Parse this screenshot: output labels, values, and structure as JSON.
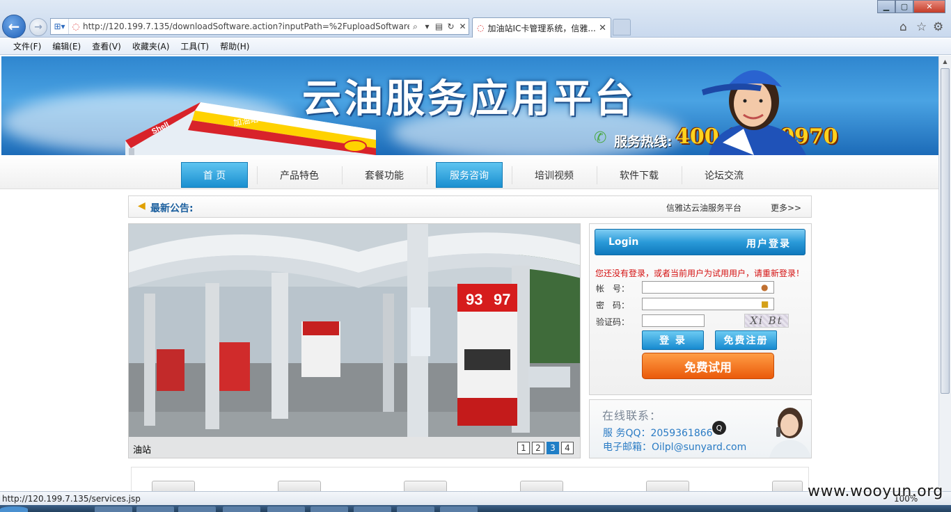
{
  "browser": {
    "url": "http://120.199.7.135/downloadSoftware.action?inputPath=%2FuploadSoftware%",
    "tab_title": "加油站IC卡管理系统，信雅...",
    "menu": [
      "文件(F)",
      "编辑(E)",
      "查看(V)",
      "收藏夹(A)",
      "工具(T)",
      "帮助(H)"
    ],
    "status_url": "http://120.199.7.135/services.jsp",
    "zoom": "100%"
  },
  "banner": {
    "title": "云油服务应用平台",
    "hotline_label": "服务热线:",
    "hotline_number": "400-826-0970",
    "canopy_text": "加油站",
    "brand": "Shell"
  },
  "nav": [
    {
      "label": "首 页",
      "active": true
    },
    {
      "label": "产品特色",
      "active": false
    },
    {
      "label": "套餐功能",
      "active": false
    },
    {
      "label": "服务咨询",
      "active": true
    },
    {
      "label": "培训视频",
      "active": false
    },
    {
      "label": "软件下载",
      "active": false
    },
    {
      "label": "论坛交流",
      "active": false
    }
  ],
  "notice": {
    "label": "最新公告:",
    "ticker": "信雅达云油服务平台",
    "more": "更多>>"
  },
  "slideshow": {
    "caption": "油站",
    "pages": [
      "1",
      "2",
      "3",
      "4"
    ],
    "active_page": 3,
    "pump_price_1": "93",
    "pump_price_2": "97"
  },
  "login": {
    "header_en": "Login",
    "header_cn": "用户登录",
    "warning": "您还没有登录，或者当前用户为试用用户，请重新登录！",
    "account_label": "帐　号：",
    "password_label": "密　码：",
    "captcha_label": "验证码：",
    "account_value": "",
    "password_value": "",
    "captcha_value": "",
    "captcha_image_text": "Xi Bt",
    "login_button": "登 录",
    "register_button": "免费注册",
    "trial_button": "免费试用"
  },
  "contact": {
    "title": "在线联系：",
    "qq": "服 务QQ：2059361866",
    "email": "电子邮箱：Oilpl@sunyard.com"
  },
  "watermark": "www.wooyun.org"
}
